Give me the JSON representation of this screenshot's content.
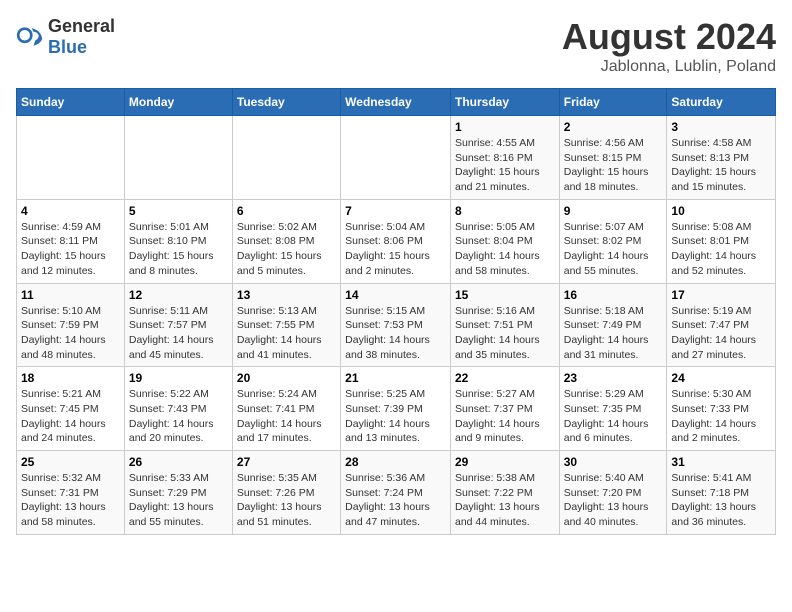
{
  "header": {
    "logo_general": "General",
    "logo_blue": "Blue",
    "month_title": "August 2024",
    "location": "Jablonna, Lublin, Poland"
  },
  "weekdays": [
    "Sunday",
    "Monday",
    "Tuesday",
    "Wednesday",
    "Thursday",
    "Friday",
    "Saturday"
  ],
  "weeks": [
    [
      {
        "day": "",
        "info": ""
      },
      {
        "day": "",
        "info": ""
      },
      {
        "day": "",
        "info": ""
      },
      {
        "day": "",
        "info": ""
      },
      {
        "day": "1",
        "info": "Sunrise: 4:55 AM\nSunset: 8:16 PM\nDaylight: 15 hours and 21 minutes."
      },
      {
        "day": "2",
        "info": "Sunrise: 4:56 AM\nSunset: 8:15 PM\nDaylight: 15 hours and 18 minutes."
      },
      {
        "day": "3",
        "info": "Sunrise: 4:58 AM\nSunset: 8:13 PM\nDaylight: 15 hours and 15 minutes."
      }
    ],
    [
      {
        "day": "4",
        "info": "Sunrise: 4:59 AM\nSunset: 8:11 PM\nDaylight: 15 hours and 12 minutes."
      },
      {
        "day": "5",
        "info": "Sunrise: 5:01 AM\nSunset: 8:10 PM\nDaylight: 15 hours and 8 minutes."
      },
      {
        "day": "6",
        "info": "Sunrise: 5:02 AM\nSunset: 8:08 PM\nDaylight: 15 hours and 5 minutes."
      },
      {
        "day": "7",
        "info": "Sunrise: 5:04 AM\nSunset: 8:06 PM\nDaylight: 15 hours and 2 minutes."
      },
      {
        "day": "8",
        "info": "Sunrise: 5:05 AM\nSunset: 8:04 PM\nDaylight: 14 hours and 58 minutes."
      },
      {
        "day": "9",
        "info": "Sunrise: 5:07 AM\nSunset: 8:02 PM\nDaylight: 14 hours and 55 minutes."
      },
      {
        "day": "10",
        "info": "Sunrise: 5:08 AM\nSunset: 8:01 PM\nDaylight: 14 hours and 52 minutes."
      }
    ],
    [
      {
        "day": "11",
        "info": "Sunrise: 5:10 AM\nSunset: 7:59 PM\nDaylight: 14 hours and 48 minutes."
      },
      {
        "day": "12",
        "info": "Sunrise: 5:11 AM\nSunset: 7:57 PM\nDaylight: 14 hours and 45 minutes."
      },
      {
        "day": "13",
        "info": "Sunrise: 5:13 AM\nSunset: 7:55 PM\nDaylight: 14 hours and 41 minutes."
      },
      {
        "day": "14",
        "info": "Sunrise: 5:15 AM\nSunset: 7:53 PM\nDaylight: 14 hours and 38 minutes."
      },
      {
        "day": "15",
        "info": "Sunrise: 5:16 AM\nSunset: 7:51 PM\nDaylight: 14 hours and 35 minutes."
      },
      {
        "day": "16",
        "info": "Sunrise: 5:18 AM\nSunset: 7:49 PM\nDaylight: 14 hours and 31 minutes."
      },
      {
        "day": "17",
        "info": "Sunrise: 5:19 AM\nSunset: 7:47 PM\nDaylight: 14 hours and 27 minutes."
      }
    ],
    [
      {
        "day": "18",
        "info": "Sunrise: 5:21 AM\nSunset: 7:45 PM\nDaylight: 14 hours and 24 minutes."
      },
      {
        "day": "19",
        "info": "Sunrise: 5:22 AM\nSunset: 7:43 PM\nDaylight: 14 hours and 20 minutes."
      },
      {
        "day": "20",
        "info": "Sunrise: 5:24 AM\nSunset: 7:41 PM\nDaylight: 14 hours and 17 minutes."
      },
      {
        "day": "21",
        "info": "Sunrise: 5:25 AM\nSunset: 7:39 PM\nDaylight: 14 hours and 13 minutes."
      },
      {
        "day": "22",
        "info": "Sunrise: 5:27 AM\nSunset: 7:37 PM\nDaylight: 14 hours and 9 minutes."
      },
      {
        "day": "23",
        "info": "Sunrise: 5:29 AM\nSunset: 7:35 PM\nDaylight: 14 hours and 6 minutes."
      },
      {
        "day": "24",
        "info": "Sunrise: 5:30 AM\nSunset: 7:33 PM\nDaylight: 14 hours and 2 minutes."
      }
    ],
    [
      {
        "day": "25",
        "info": "Sunrise: 5:32 AM\nSunset: 7:31 PM\nDaylight: 13 hours and 58 minutes."
      },
      {
        "day": "26",
        "info": "Sunrise: 5:33 AM\nSunset: 7:29 PM\nDaylight: 13 hours and 55 minutes."
      },
      {
        "day": "27",
        "info": "Sunrise: 5:35 AM\nSunset: 7:26 PM\nDaylight: 13 hours and 51 minutes."
      },
      {
        "day": "28",
        "info": "Sunrise: 5:36 AM\nSunset: 7:24 PM\nDaylight: 13 hours and 47 minutes."
      },
      {
        "day": "29",
        "info": "Sunrise: 5:38 AM\nSunset: 7:22 PM\nDaylight: 13 hours and 44 minutes."
      },
      {
        "day": "30",
        "info": "Sunrise: 5:40 AM\nSunset: 7:20 PM\nDaylight: 13 hours and 40 minutes."
      },
      {
        "day": "31",
        "info": "Sunrise: 5:41 AM\nSunset: 7:18 PM\nDaylight: 13 hours and 36 minutes."
      }
    ]
  ]
}
